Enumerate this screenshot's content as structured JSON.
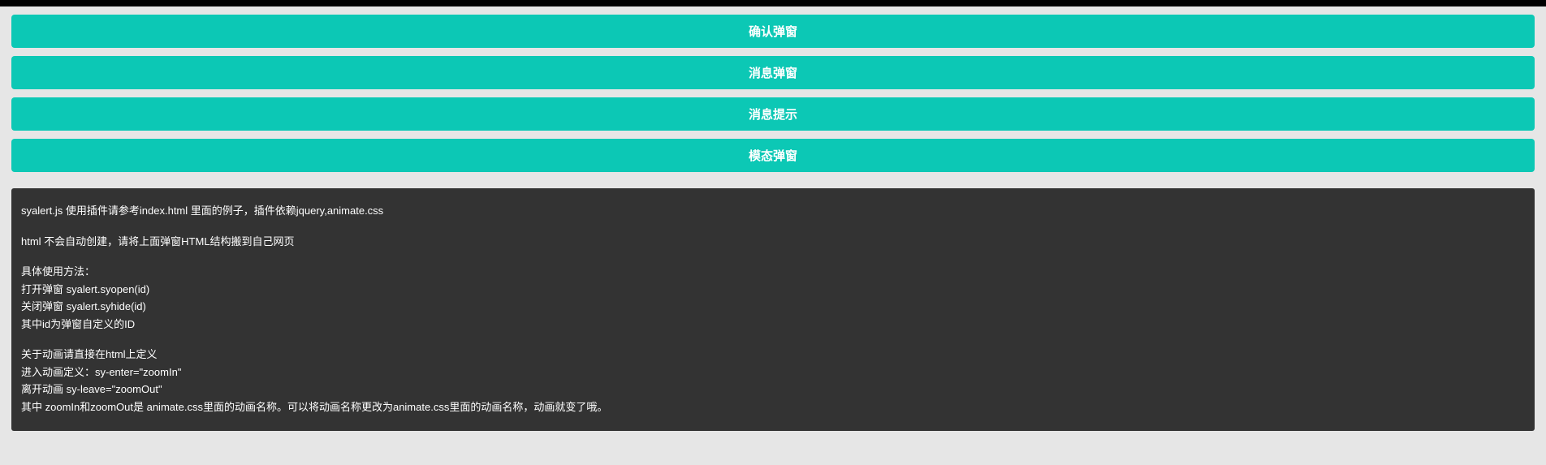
{
  "buttons": [
    {
      "label": "确认弹窗"
    },
    {
      "label": "消息弹窗"
    },
    {
      "label": "消息提示"
    },
    {
      "label": "模态弹窗"
    }
  ],
  "doc": {
    "intro": "syalert.js 使用插件请参考index.html 里面的例子，插件依赖jquery,animate.css",
    "note": "html 不会自动创建，请将上面弹窗HTML结构搬到自己网页",
    "usage_title": "具体使用方法：",
    "usage_open": "打开弹窗 syalert.syopen(id)",
    "usage_close": "关闭弹窗 syalert.syhide(id)",
    "usage_id": "其中id为弹窗自定义的ID",
    "anim_title": "关于动画请直接在html上定义",
    "anim_enter": "进入动画定义：sy-enter=\"zoomIn\"",
    "anim_leave": "离开动画 sy-leave=\"zoomOut\"",
    "anim_note": "其中 zoomIn和zoomOut是 animate.css里面的动画名称。可以将动画名称更改为animate.css里面的动画名称，动画就变了哦。"
  }
}
